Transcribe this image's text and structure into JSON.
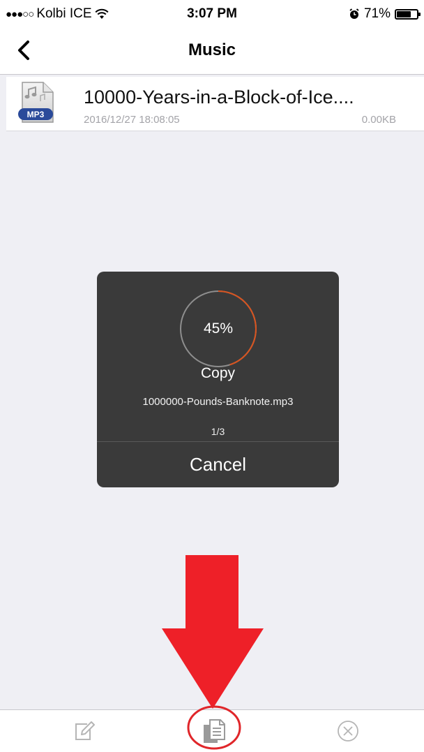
{
  "status_bar": {
    "carrier": "Kolbi ICE",
    "time": "3:07 PM",
    "battery_text": "71%",
    "battery_level": 0.71
  },
  "nav": {
    "title": "Music"
  },
  "file": {
    "name": "10000-Years-in-a-Block-of-Ice....",
    "date": "2016/12/27 18:08:05",
    "size": "0.00KB",
    "icon_label": "MP3"
  },
  "dialog": {
    "percent_text": "45%",
    "progress": 0.45,
    "title": "Copy",
    "filename": "1000000-Pounds-Banknote.mp3",
    "count": "1/3",
    "cancel_label": "Cancel"
  },
  "colors": {
    "annotation_red": "#ee2028",
    "progress_accent": "#d9531e",
    "dialog_bg": "#3a3a3a"
  },
  "toolbar": {
    "icons": [
      "edit-icon",
      "copy-icon",
      "close-circle-icon"
    ]
  }
}
